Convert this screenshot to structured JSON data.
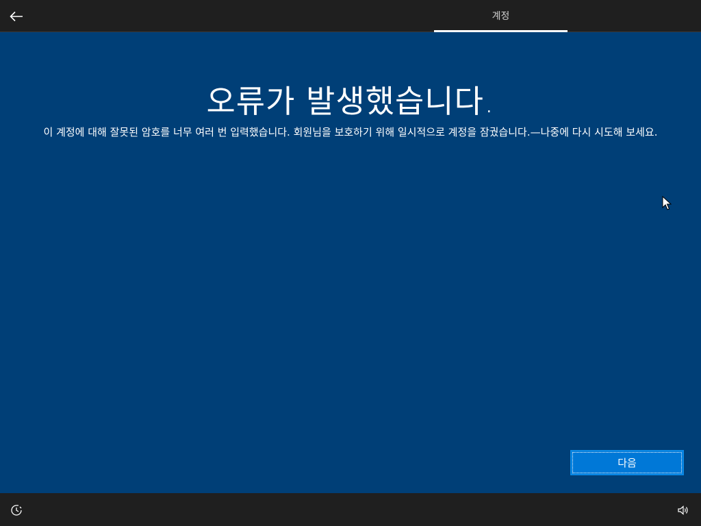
{
  "header": {
    "back_icon": "arrow-left-icon",
    "tab_label": "계정"
  },
  "main": {
    "title": "오류가 발생했습니다.",
    "message": "이 계정에 대해 잘못된 암호를 너무 여러 번 입력했습니다. 회원님을 보호하기 위해 일시적으로 계정을 잠궜습니다.—나중에 다시 시도해 보세요."
  },
  "footer": {
    "next_label": "다음",
    "ease_of_access_icon": "ease-of-access-icon",
    "volume_icon": "speaker-volume-icon"
  },
  "colors": {
    "background": "#003f77",
    "bar": "#1f1f1f",
    "accent": "#0078d7"
  }
}
